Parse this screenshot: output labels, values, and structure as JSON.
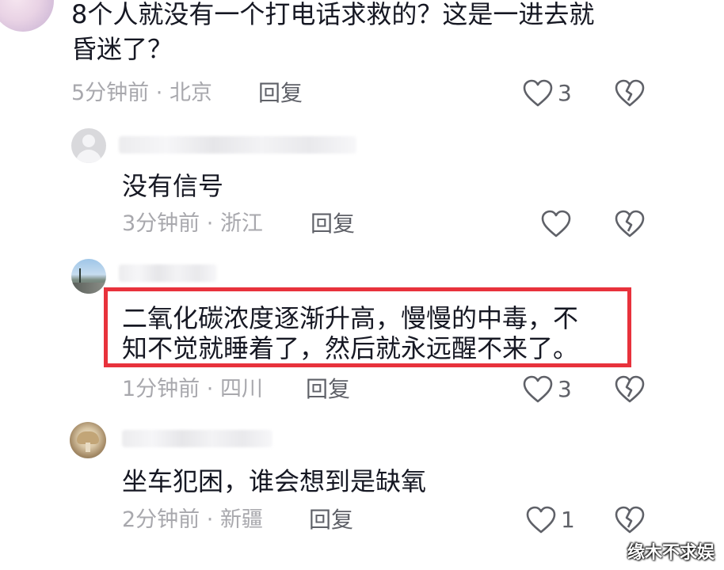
{
  "comments": [
    {
      "text_lines": [
        "8个人就没有一个打电话求救的？这是一进去就",
        "昏迷了？"
      ],
      "time": "5分钟前",
      "location": "北京",
      "reply_label": "回复",
      "likes": "3"
    },
    {
      "text_lines": [
        "没有信号"
      ],
      "time": "3分钟前",
      "location": "浙江",
      "reply_label": "回复",
      "likes": ""
    },
    {
      "text_lines": [
        "二氧化碳浓度逐渐升高，慢慢的中毒，不",
        "知不觉就睡着了，然后就永远醒不来了。"
      ],
      "time": "1分钟前",
      "location": "四川",
      "reply_label": "回复",
      "likes": "3"
    },
    {
      "text_lines": [
        "坐车犯困，谁会想到是缺氧"
      ],
      "time": "2分钟前",
      "location": "新疆",
      "reply_label": "回复",
      "likes": "1"
    }
  ],
  "separator": " · ",
  "icons": {
    "like": "heart-outline-icon",
    "dislike": "broken-heart-icon"
  },
  "colors": {
    "highlight_border": "#e8323c",
    "meta_text": "#a8a8ad",
    "body_text": "#161823"
  },
  "watermark": "缘木不求娱"
}
